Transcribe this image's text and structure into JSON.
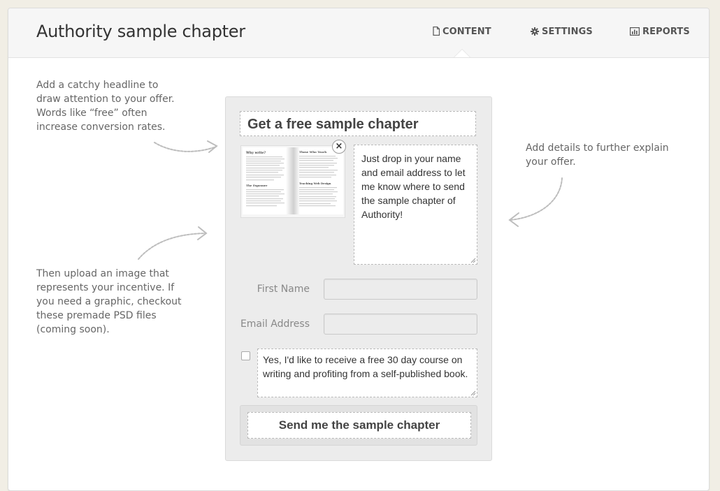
{
  "header": {
    "title": "Authority sample chapter",
    "tabs": [
      {
        "label": "CONTENT",
        "icon": "document-icon",
        "active": true
      },
      {
        "label": "SETTINGS",
        "icon": "gear-icon",
        "active": false
      },
      {
        "label": "REPORTS",
        "icon": "bar-chart-icon",
        "active": false
      }
    ]
  },
  "help": {
    "headline_tip": "Add a catchy headline to draw attention to your offer. Words like “free” often increase conversion rates.",
    "image_tip": "Then upload an image that represents your incentive. If you need a graphic, checkout these premade PSD files (coming soon).",
    "details_tip": "Add details to further explain your offer."
  },
  "form": {
    "headline": "Get a free sample chapter",
    "details": "Just drop in your name and email address to let me know where to send the sample chapter of Authority!",
    "first_name_label": "First Name",
    "email_label": "Email Address",
    "first_name_value": "",
    "email_value": "",
    "optin_checked": false,
    "optin_text": "Yes, I'd like to receive a free 30 day course on writing and profiting from a self-published book.",
    "submit_label": "Send me the sample chapter",
    "remove_image_glyph": "×"
  },
  "book_preview": {
    "left_heading_1": "Why write?",
    "left_heading_2": "The Exposure",
    "right_heading_1": "Those Who Teach",
    "right_heading_2": "Teaching Web Design"
  },
  "colors": {
    "page_bg": "#f1eee5",
    "panel_bg": "#ffffff",
    "header_bg": "#f6f6f6",
    "form_bg": "#ececec",
    "text_dark": "#333333",
    "text_muted": "#666666"
  }
}
